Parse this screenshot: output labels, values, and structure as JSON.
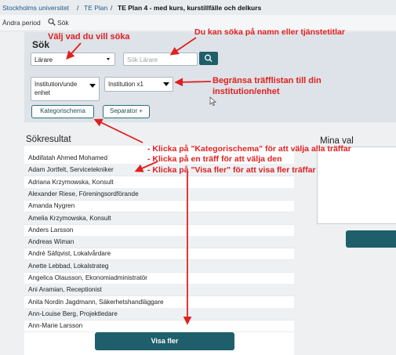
{
  "breadcrumb": {
    "root": "Stockholms universitet",
    "sep": "/",
    "plan": "TE Plan",
    "current": "TE Plan 4 - med kurs, kurstillfälle och delkurs"
  },
  "subnav": {
    "change_period": "Ändra period",
    "search": "Sök"
  },
  "search_panel": {
    "title": "Sök",
    "type_select_value": "Lärare",
    "search_placeholder": "Sök Lärare",
    "filter1_value": "Institution/unde\nenhet",
    "filter2_value": "Institution x1",
    "category_button": "Kategorischema",
    "separator_button": "Separator +"
  },
  "results": {
    "title": "Sökresultat",
    "items": [
      "Abdifatah Ahmed Mohamed",
      "Adam Jortfelt, Servicetekniker",
      "Adriana Krzymowska, Konsult",
      "Alexander Riese, Föreningsordförande",
      "Amanda Nygren",
      "Amelia Krzymowska, Konsult",
      "Anders Larsson",
      "Andreas Wiman",
      "André Säfqvist, Lokalvårdare",
      "Anette Lebbad, Lokalstrateg",
      "Angelica Olausson, Ekonomiadministratör",
      "Ani Aramian, Receptionist",
      "Anita Nordin Jagdmann, Säkerhetshandläggare",
      "Ann-Louise Berg, Projektledare",
      "Ann-Marie Larsson"
    ],
    "show_more": "Visa fler"
  },
  "selections": {
    "title": "Mina val"
  },
  "annotations": {
    "choose_type": "Välj vad du vill söka",
    "search_hint": "Du kan söka på namn eller tjänstetitlar",
    "filter_hint_1": "Begränsa träfflistan till din",
    "filter_hint_2": "institution/enhet",
    "instr_1": "- Klicka på \"Kategorischema\" för att välja alla träffar",
    "instr_2": "- Klicka på en träff för att välja den",
    "instr_3": "- Klicka på \"Visa fler\" för att visa fler träffar"
  },
  "icons": {
    "search": "magnifier-icon",
    "dropdown": "caret-down-icon",
    "cursor": "mouse-pointer-icon"
  },
  "colors": {
    "accent": "#1e5f6b",
    "annotation": "#e02020",
    "link": "#1d5a8e",
    "panel": "#dde3e8"
  }
}
